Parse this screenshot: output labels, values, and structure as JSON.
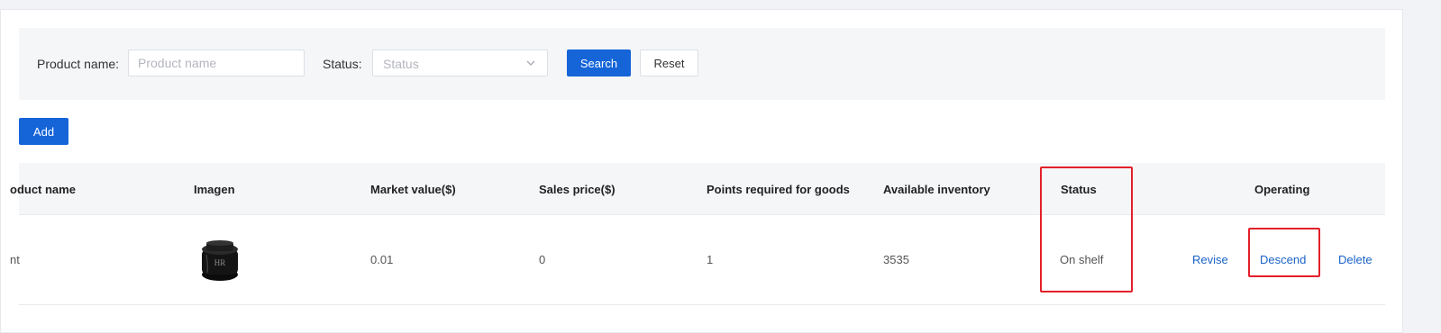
{
  "filters": {
    "product_name_label": "Product name:",
    "product_name_placeholder": "Product name",
    "status_label": "Status:",
    "status_placeholder": "Status",
    "search_label": "Search",
    "reset_label": "Reset"
  },
  "toolbar": {
    "add_label": "Add"
  },
  "table": {
    "headers": {
      "product_name": "oduct name",
      "image": "Imagen",
      "market_value": "Market value($)",
      "sales_price": "Sales price($)",
      "points": "Points required for goods",
      "inventory": "Available inventory",
      "status": "Status",
      "operating": "Operating"
    },
    "rows": [
      {
        "product_name": "nt",
        "image_icon": "cream-jar-icon",
        "market_value": "0.01",
        "sales_price": "0",
        "points": "1",
        "inventory": "3535",
        "status": "On shelf",
        "actions": {
          "revise": "Revise",
          "descend": "Descend",
          "delete": "Delete"
        }
      }
    ]
  },
  "colors": {
    "primary": "#1565d8",
    "link": "#1a63c7",
    "highlight": "#e3202a"
  }
}
